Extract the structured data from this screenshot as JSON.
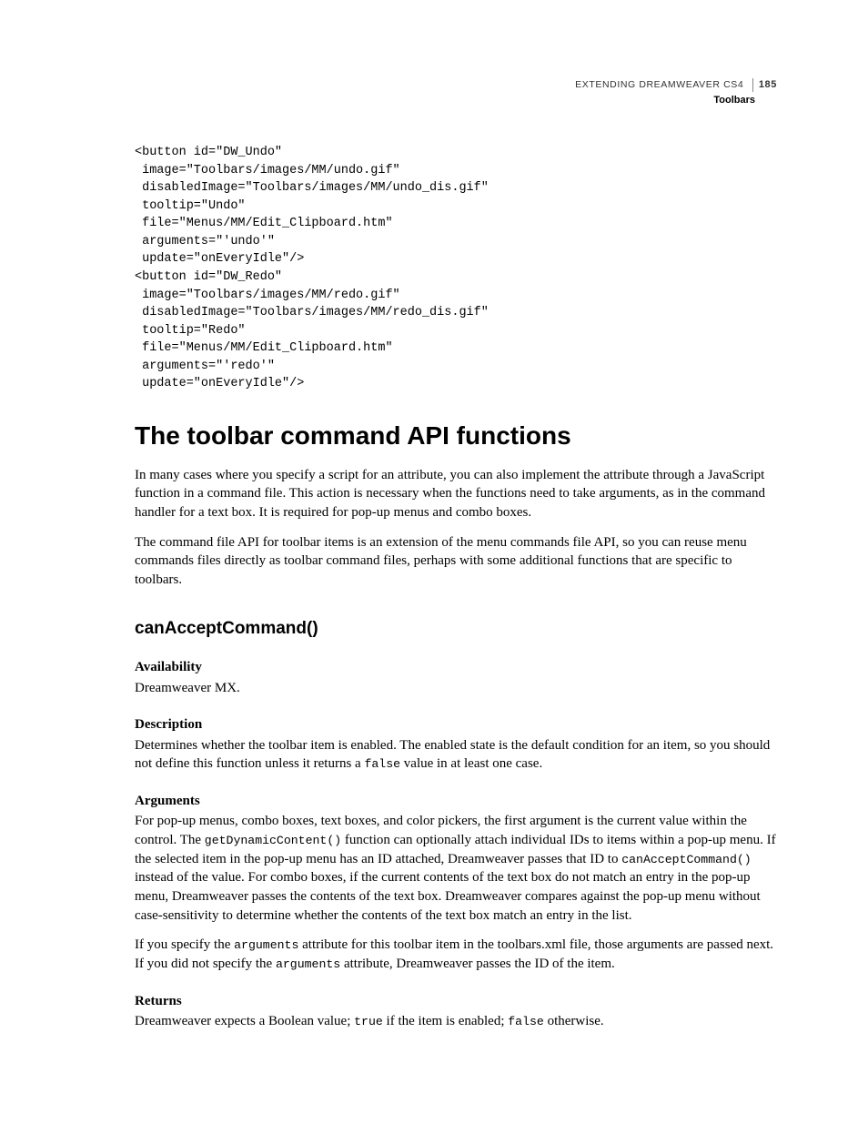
{
  "header": {
    "doc_title": "EXTENDING DREAMWEAVER CS4",
    "page_number": "185",
    "section": "Toolbars"
  },
  "code_block": "<button id=\"DW_Undo\"\n image=\"Toolbars/images/MM/undo.gif\"\n disabledImage=\"Toolbars/images/MM/undo_dis.gif\"\n tooltip=\"Undo\"\n file=\"Menus/MM/Edit_Clipboard.htm\"\n arguments=\"'undo'\"\n update=\"onEveryIdle\"/>\n<button id=\"DW_Redo\"\n image=\"Toolbars/images/MM/redo.gif\"\n disabledImage=\"Toolbars/images/MM/redo_dis.gif\"\n tooltip=\"Redo\"\n file=\"Menus/MM/Edit_Clipboard.htm\"\n arguments=\"'redo'\"\n update=\"onEveryIdle\"/>",
  "h1": "The toolbar command API functions",
  "intro_p1": "In many cases where you specify a script for an attribute, you can also implement the attribute through a JavaScript function in a command file. This action is necessary when the functions need to take arguments, as in the command handler for a text box. It is required for pop-up menus and combo boxes.",
  "intro_p2": "The command file API for toolbar items is an extension of the menu commands file API, so you can reuse menu commands files directly as toolbar command files, perhaps with some additional functions that are specific to toolbars.",
  "func_heading": "canAcceptCommand()",
  "availability": {
    "label": "Availability",
    "text": "Dreamweaver MX."
  },
  "description": {
    "label": "Description",
    "pre": "Determines whether the toolbar item is enabled. The enabled state is the default condition for an item, so you should not define this function unless it returns a ",
    "code": "false",
    "post": " value in at least one case."
  },
  "arguments": {
    "label": "Arguments",
    "p1_pre": "For pop-up menus, combo boxes, text boxes, and color pickers, the first argument is the current value within the control. The ",
    "p1_code1": "getDynamicContent()",
    "p1_mid": " function can optionally attach individual IDs to items within a pop-up menu. If the selected item in the pop-up menu has an ID attached, Dreamweaver passes that ID to ",
    "p1_code2": "canAcceptCommand()",
    "p1_post": " instead of the value. For combo boxes, if the current contents of the text box do not match an entry in the pop-up menu, Dreamweaver passes the contents of the text box. Dreamweaver compares against the pop-up menu without case-sensitivity to determine whether the contents of the text box match an entry in the list.",
    "p2_pre": "If you specify the ",
    "p2_code1": "arguments",
    "p2_mid": " attribute for this toolbar item in the toolbars.xml file, those arguments are passed next. If you did not specify the ",
    "p2_code2": "arguments",
    "p2_post": " attribute, Dreamweaver passes the ID of the item."
  },
  "returns": {
    "label": "Returns",
    "pre": "Dreamweaver expects a Boolean value; ",
    "code1": "true",
    "mid": " if the item is enabled; ",
    "code2": "false",
    "post": " otherwise."
  }
}
